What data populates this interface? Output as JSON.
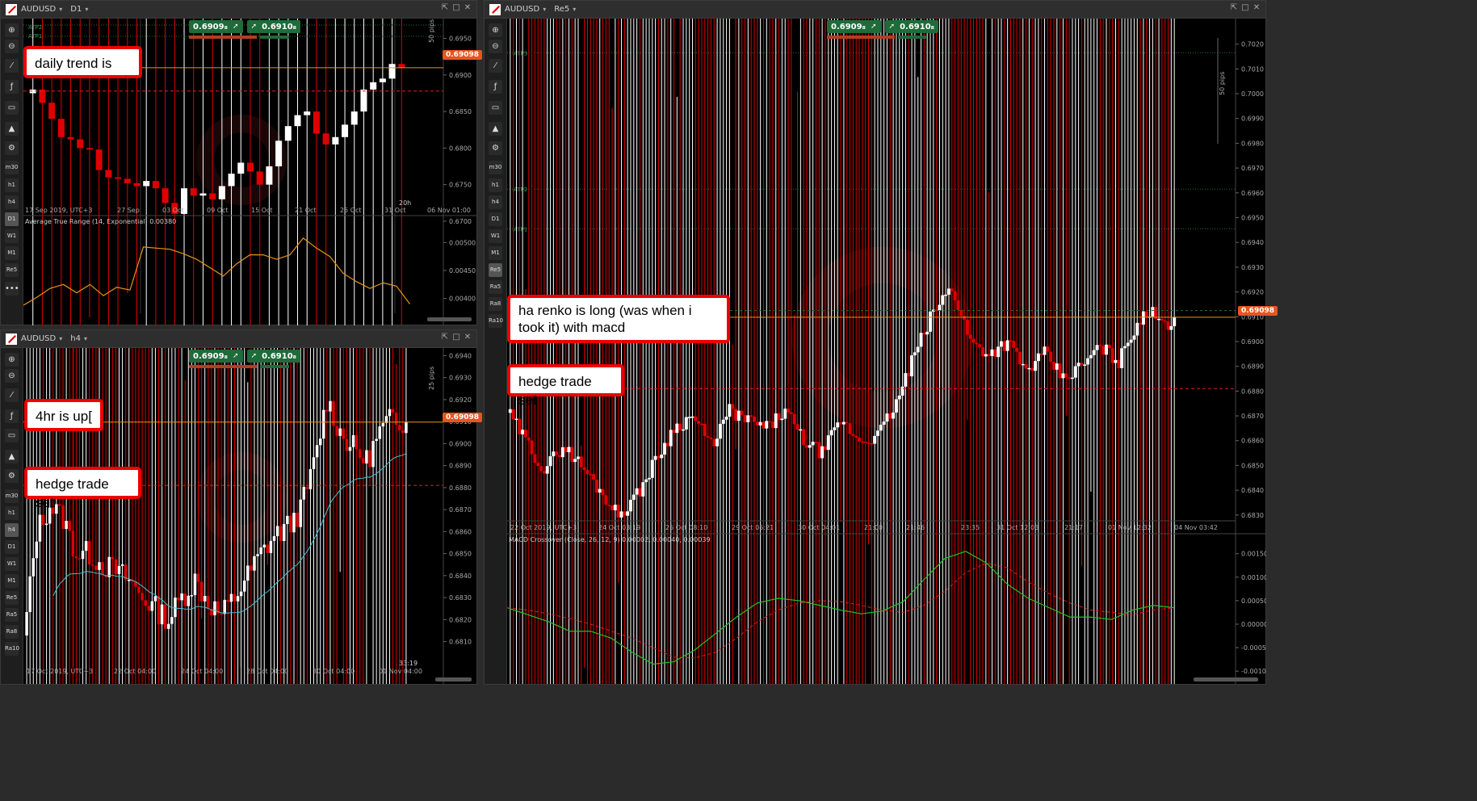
{
  "panels": {
    "daily": {
      "symbol": "AUDUSD",
      "timeframe": "D1",
      "bid": "0.6909₈",
      "ask": "0.6910₈",
      "price_tag": "0.69098",
      "pips_label": "50 pips",
      "time_badge": "20h",
      "price_ticks": [
        "0.6950",
        "0.6900",
        "0.6850",
        "0.6800",
        "0.6750",
        "0.6700"
      ],
      "date_ticks": [
        "17 Sep 2019, UTC+3",
        "27 Sep",
        "03 Oct",
        "09 Oct",
        "15 Oct",
        "21 Oct",
        "25 Oct",
        "31 Oct",
        "06 Nov 01:00"
      ],
      "indicator_label": "Average True Range (14, Exponential) 0.00380",
      "indicator_ticks": [
        "0.00500",
        "0.00450",
        "0.00400"
      ],
      "atp_labels": [
        "ATP2",
        "ATP1"
      ],
      "note": "daily trend is up"
    },
    "h4": {
      "symbol": "AUDUSD",
      "timeframe": "h4",
      "bid": "0.6909₈",
      "ask": "0.6910₈",
      "price_tag": "0.69098",
      "pips_label": "25 pips",
      "time_badge": "33:19",
      "price_ticks": [
        "0.6940",
        "0.6930",
        "0.6920",
        "0.6910",
        "0.6900",
        "0.6890",
        "0.6880",
        "0.6870",
        "0.6860",
        "0.6850",
        "0.6840",
        "0.6830",
        "0.6820",
        "0.6810"
      ],
      "date_ticks": [
        "17 Oct 2019, UTC+3",
        "22 Oct 04:00",
        "24 Oct 04:00",
        "28 Oct 04:00",
        "30 Oct 04:00",
        "01 Nov 04:00"
      ],
      "note_up": "4hr is up[",
      "note_hedge": "hedge trade set"
    },
    "renko": {
      "symbol": "AUDUSD",
      "timeframe": "Re5",
      "bid": "0.6909₈",
      "ask": "0.6910₈",
      "price_tag": "0.69098",
      "pips_label": "50 pips",
      "price_ticks": [
        "0.7020",
        "0.7010",
        "0.7000",
        "0.6990",
        "0.6980",
        "0.6970",
        "0.6960",
        "0.6950",
        "0.6940",
        "0.6930",
        "0.6920",
        "0.6910",
        "0.6900",
        "0.6890",
        "0.6880",
        "0.6870",
        "0.6860",
        "0.6850",
        "0.6840",
        "0.6830"
      ],
      "date_ticks": [
        "22 Oct 2019, UTC+3",
        "24 Oct 03:19",
        "25 Oct 08:10",
        "29 Oct 05:21",
        "30 Oct 04:01",
        "21:00",
        "21:46",
        "23:35",
        "31 Oct 12:06",
        "21:17",
        "01 Nov 12:32",
        "04 Nov 03:42"
      ],
      "atp_labels": [
        "ATP3",
        "ATP2",
        "ATP1"
      ],
      "indicator_label": "MACD Crossover (Close, 26, 12, 9) 0.00002, 0.00040, 0.00039",
      "indicator_ticks": [
        "0.00150",
        "0.00100",
        "0.00050",
        "0.00000",
        "-0.00050",
        "-0.00100"
      ],
      "note_long": "ha renko is long (was when i took it) with macd",
      "note_hedge": "hedge trade set"
    }
  },
  "toolbar": {
    "timeframes": [
      "m30",
      "h1",
      "h4",
      "D1",
      "W1",
      "M1",
      "Re5",
      "Ra5",
      "Ra8",
      "Ra10"
    ]
  },
  "colors": {
    "bull": "#ffffff",
    "bear": "#e00000",
    "bid_bg": "#1f6b3a",
    "price_tag": "#e8541f",
    "atr_line": "#e8941a",
    "ema_line": "#3cc6d6",
    "macd": "#22c322",
    "signal": "#e02020"
  }
}
